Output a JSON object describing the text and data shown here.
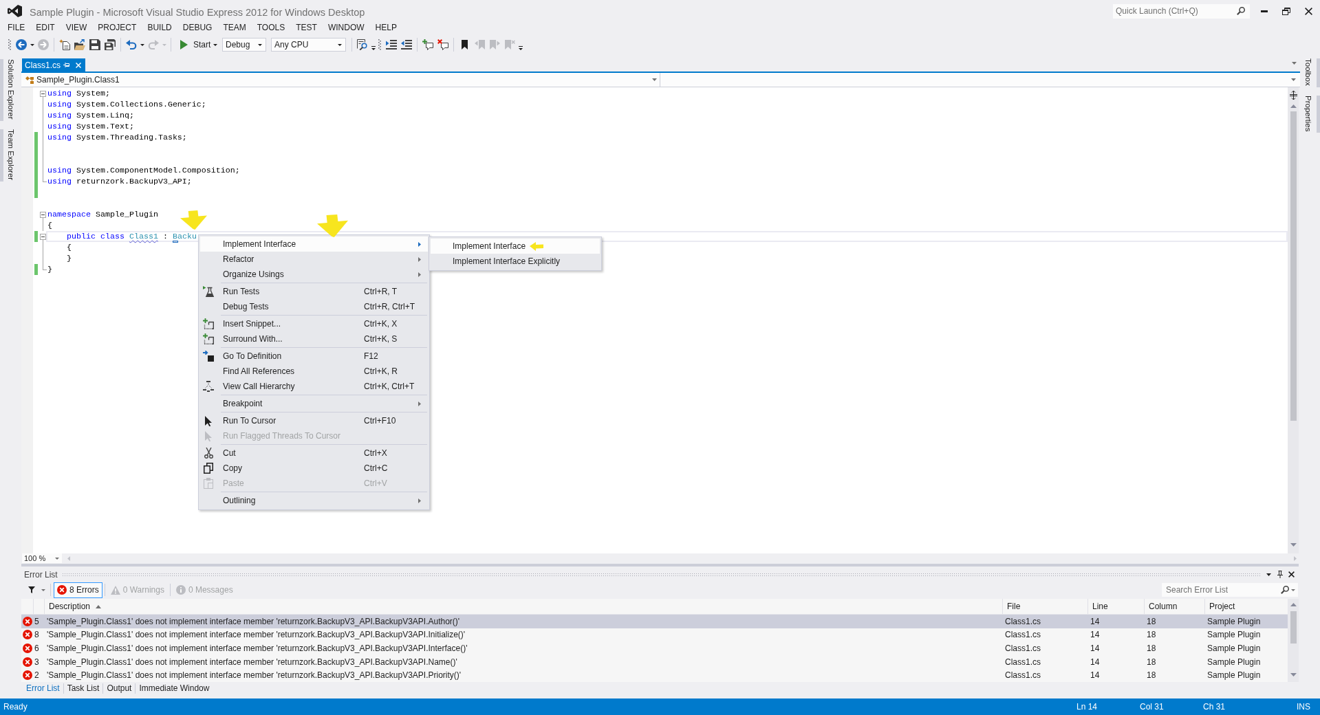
{
  "window": {
    "title": "Sample Plugin - Microsoft Visual Studio Express 2012 for Windows Desktop",
    "quick_launch": {
      "placeholder": "Quick Launch (Ctrl+Q)"
    }
  },
  "menu_bar": [
    "FILE",
    "EDIT",
    "VIEW",
    "PROJECT",
    "BUILD",
    "DEBUG",
    "TEAM",
    "TOOLS",
    "TEST",
    "WINDOW",
    "HELP"
  ],
  "toolbars": [
    {
      "groups": [
        [
          {
            "kind": "icon",
            "dropdown": true,
            "disabled": false
          },
          {
            "kind": "icon",
            "dropdown": false,
            "disabled": true
          }
        ],
        [
          {
            "kind": "icon",
            "dropdown": false,
            "disabled": false
          },
          {
            "kind": "icon",
            "dropdown": false,
            "disabled": false
          },
          {
            "kind": "icon",
            "dropdown": false,
            "disabled": false
          },
          {
            "kind": "icon",
            "dropdown": false,
            "disabled": false
          }
        ],
        [
          {
            "kind": "icon",
            "dropdown": true,
            "disabled": false
          },
          {
            "kind": "icon",
            "dropdown": true,
            "disabled": true
          }
        ],
        [
          {
            "kind": "start",
            "label": "Start",
            "dropdown": true,
            "disabled": false
          },
          {
            "kind": "combo",
            "value": "Debug",
            "dropdown": true,
            "disabled": false
          },
          {
            "kind": "combo",
            "value": "Any CPU",
            "dropdown": true,
            "disabled": false
          }
        ],
        [
          {
            "kind": "icon",
            "dropdown": false,
            "disabled": false
          }
        ]
      ]
    },
    {
      "groups": [
        [
          {
            "kind": "icon",
            "dropdown": false,
            "disabled": false
          },
          {
            "kind": "icon",
            "dropdown": false,
            "disabled": false
          }
        ],
        [
          {
            "kind": "icon",
            "dropdown": false,
            "disabled": false
          },
          {
            "kind": "icon",
            "dropdown": false,
            "disabled": false
          }
        ],
        [
          {
            "kind": "icon",
            "dropdown": false,
            "disabled": false
          },
          {
            "kind": "icon",
            "dropdown": false,
            "disabled": true
          },
          {
            "kind": "icon",
            "dropdown": false,
            "disabled": true
          },
          {
            "kind": "icon",
            "dropdown": false,
            "disabled": true
          }
        ]
      ]
    }
  ],
  "left_dock": [
    "Solution Explorer",
    "Team Explorer"
  ],
  "right_dock": [
    "Toolbox",
    "Properties"
  ],
  "document": {
    "tabs": [
      {
        "label": "Class1.cs",
        "selected": true
      }
    ],
    "navigation": {
      "type": "Sample_Plugin.Class1"
    },
    "code": [
      {
        "changed": false,
        "lines": [
          {
            "kind": "start",
            "tokens": [
              {
                "kind": "keyword",
                "text": "using"
              },
              {
                "kind": "plain",
                "text": " System;"
              }
            ],
            "current": false
          },
          {
            "kind": "inside",
            "tokens": [
              {
                "kind": "keyword",
                "text": "using"
              },
              {
                "kind": "plain",
                "text": " System.Collections.Generic;"
              }
            ],
            "current": false
          },
          {
            "kind": "inside",
            "tokens": [
              {
                "kind": "keyword",
                "text": "using"
              },
              {
                "kind": "plain",
                "text": " System.Linq;"
              }
            ],
            "current": false
          },
          {
            "kind": "inside",
            "tokens": [
              {
                "kind": "keyword",
                "text": "using"
              },
              {
                "kind": "plain",
                "text": " System.Text;"
              }
            ],
            "current": false
          }
        ]
      },
      {
        "changed": true,
        "lines": [
          {
            "kind": "inside",
            "tokens": [
              {
                "kind": "keyword",
                "text": "using"
              },
              {
                "kind": "plain",
                "text": " System.Threading.Tasks;"
              }
            ],
            "current": false
          },
          {
            "kind": "inside",
            "current": false
          },
          {
            "kind": "inside",
            "current": false
          },
          {
            "kind": "inside",
            "tokens": [
              {
                "kind": "keyword",
                "text": "using"
              },
              {
                "kind": "plain",
                "text": " System.ComponentModel.Composition;"
              }
            ],
            "current": false
          },
          {
            "kind": "end",
            "tokens": [
              {
                "kind": "keyword",
                "text": "using"
              },
              {
                "kind": "plain",
                "text": " returnzork.BackupV3_API;"
              }
            ],
            "current": false
          },
          {
            "kind": "outside",
            "current": false
          }
        ]
      },
      {
        "changed": false,
        "lines": [
          {
            "kind": "outside",
            "current": false
          },
          {
            "kind": "start",
            "tokens": [
              {
                "kind": "keyword",
                "text": "namespace"
              },
              {
                "kind": "plain",
                "text": " Sample_Plugin"
              }
            ],
            "current": false
          },
          {
            "kind": "inside",
            "tokens": [
              {
                "kind": "plain",
                "text": "{"
              }
            ],
            "current": false
          }
        ]
      },
      {
        "changed": true,
        "lines": [
          {
            "kind": "start",
            "tokens": [
              {
                "kind": "keyword",
                "text": "    public class "
              },
              {
                "kind": "type-error",
                "text": "Class1"
              },
              {
                "kind": "plain",
                "text": " : "
              },
              {
                "kind": "type-tag",
                "text": "Backu"
              }
            ],
            "current": true
          }
        ]
      },
      {
        "changed": false,
        "lines": [
          {
            "kind": "inside",
            "tokens": [
              {
                "kind": "plain",
                "text": "    {"
              }
            ],
            "current": false
          },
          {
            "kind": "inside",
            "tokens": [
              {
                "kind": "plain",
                "text": "    }"
              }
            ],
            "current": false
          }
        ]
      },
      {
        "changed": true,
        "lines": [
          {
            "kind": "end",
            "tokens": [
              {
                "kind": "plain",
                "text": "}"
              }
            ],
            "current": false
          }
        ]
      }
    ],
    "zoom": "100 %"
  },
  "context_menu": {
    "groups": [
      [
        {
          "label": "Implement Interface",
          "has_submenu": true,
          "expanded": true,
          "selected": true,
          "disabled": false,
          "submenu": [
            {
              "label": "Implement Interface",
              "selected": true
            },
            {
              "label": "Implement Interface Explicitly",
              "selected": false
            }
          ]
        },
        {
          "label": "Refactor",
          "has_submenu": true,
          "expanded": false,
          "selected": false,
          "disabled": false
        },
        {
          "label": "Organize Usings",
          "has_submenu": true,
          "expanded": false,
          "selected": false,
          "disabled": false
        }
      ],
      [
        {
          "label": "Run Tests",
          "shortcut": "Ctrl+R, T",
          "has_submenu": false,
          "selected": false,
          "disabled": false
        },
        {
          "label": "Debug Tests",
          "shortcut": "Ctrl+R, Ctrl+T",
          "has_submenu": false,
          "selected": false,
          "disabled": false
        }
      ],
      [
        {
          "label": "Insert Snippet...",
          "shortcut": "Ctrl+K, X",
          "has_submenu": false,
          "selected": false,
          "disabled": false
        },
        {
          "label": "Surround With...",
          "shortcut": "Ctrl+K, S",
          "has_submenu": false,
          "selected": false,
          "disabled": false
        }
      ],
      [
        {
          "label": "Go To Definition",
          "shortcut": "F12",
          "has_submenu": false,
          "selected": false,
          "disabled": false
        },
        {
          "label": "Find All References",
          "shortcut": "Ctrl+K, R",
          "has_submenu": false,
          "selected": false,
          "disabled": false
        },
        {
          "label": "View Call Hierarchy",
          "shortcut": "Ctrl+K, Ctrl+T",
          "has_submenu": false,
          "selected": false,
          "disabled": false
        }
      ],
      [
        {
          "label": "Breakpoint",
          "has_submenu": true,
          "expanded": false,
          "selected": false,
          "disabled": false
        }
      ],
      [
        {
          "label": "Run To Cursor",
          "shortcut": "Ctrl+F10",
          "has_submenu": false,
          "selected": false,
          "disabled": false
        },
        {
          "label": "Run Flagged Threads To Cursor",
          "has_submenu": false,
          "selected": false,
          "disabled": true
        }
      ],
      [
        {
          "label": "Cut",
          "shortcut": "Ctrl+X",
          "has_submenu": false,
          "selected": false,
          "disabled": false
        },
        {
          "label": "Copy",
          "shortcut": "Ctrl+C",
          "has_submenu": false,
          "selected": false,
          "disabled": false
        },
        {
          "label": "Paste",
          "shortcut": "Ctrl+V",
          "has_submenu": false,
          "selected": false,
          "disabled": true
        }
      ],
      [
        {
          "label": "Outlining",
          "has_submenu": true,
          "expanded": false,
          "selected": false,
          "disabled": false
        }
      ]
    ]
  },
  "error_list": {
    "title": "Error List",
    "filters": [
      {
        "kind": "error",
        "label": "8 Errors",
        "selected": true,
        "disabled": false
      },
      {
        "kind": "warning",
        "label": "0 Warnings",
        "selected": false,
        "disabled": true
      },
      {
        "kind": "message",
        "label": "0 Messages",
        "selected": false,
        "disabled": true
      }
    ],
    "search": {
      "placeholder": "Search Error List"
    },
    "columns": [
      {
        "label": "Description",
        "sorted": true
      },
      {
        "label": "File",
        "sorted": false
      },
      {
        "label": "Line",
        "sorted": false
      },
      {
        "label": "Column",
        "sorted": false
      },
      {
        "label": "Project",
        "sorted": false
      }
    ],
    "rows": [
      {
        "kind": "error",
        "number": "5",
        "description": "'Sample_Plugin.Class1' does not implement interface member 'returnzork.BackupV3_API.BackupV3API.Author()'",
        "file": "Class1.cs",
        "line": "14",
        "column": "18",
        "project": "Sample Plugin",
        "selected": true
      },
      {
        "kind": "error",
        "number": "8",
        "description": "'Sample_Plugin.Class1' does not implement interface member 'returnzork.BackupV3_API.BackupV3API.Initialize()'",
        "file": "Class1.cs",
        "line": "14",
        "column": "18",
        "project": "Sample Plugin",
        "selected": false
      },
      {
        "kind": "error",
        "number": "6",
        "description": "'Sample_Plugin.Class1' does not implement interface member 'returnzork.BackupV3_API.BackupV3API.Interface()'",
        "file": "Class1.cs",
        "line": "14",
        "column": "18",
        "project": "Sample Plugin",
        "selected": false
      },
      {
        "kind": "error",
        "number": "3",
        "description": "'Sample_Plugin.Class1' does not implement interface member 'returnzork.BackupV3_API.BackupV3API.Name()'",
        "file": "Class1.cs",
        "line": "14",
        "column": "18",
        "project": "Sample Plugin",
        "selected": false
      },
      {
        "kind": "error",
        "number": "2",
        "description": "'Sample_Plugin.Class1' does not implement interface member 'returnzork.BackupV3_API.BackupV3API.Priority()'",
        "file": "Class1.cs",
        "line": "14",
        "column": "18",
        "project": "Sample Plugin",
        "selected": false
      }
    ],
    "tabs": [
      {
        "label": "Error List",
        "selected": true
      },
      {
        "label": "Task List",
        "selected": false
      },
      {
        "label": "Output",
        "selected": false
      },
      {
        "label": "Immediate Window",
        "selected": false
      }
    ]
  },
  "status_bar": {
    "message": "Ready",
    "line": "Ln 14",
    "column": "Col 31",
    "character": "Ch 31",
    "mode": "INS"
  },
  "annotation_arrows": [
    {
      "kind": "down"
    },
    {
      "kind": "down"
    },
    {
      "kind": "left"
    }
  ]
}
